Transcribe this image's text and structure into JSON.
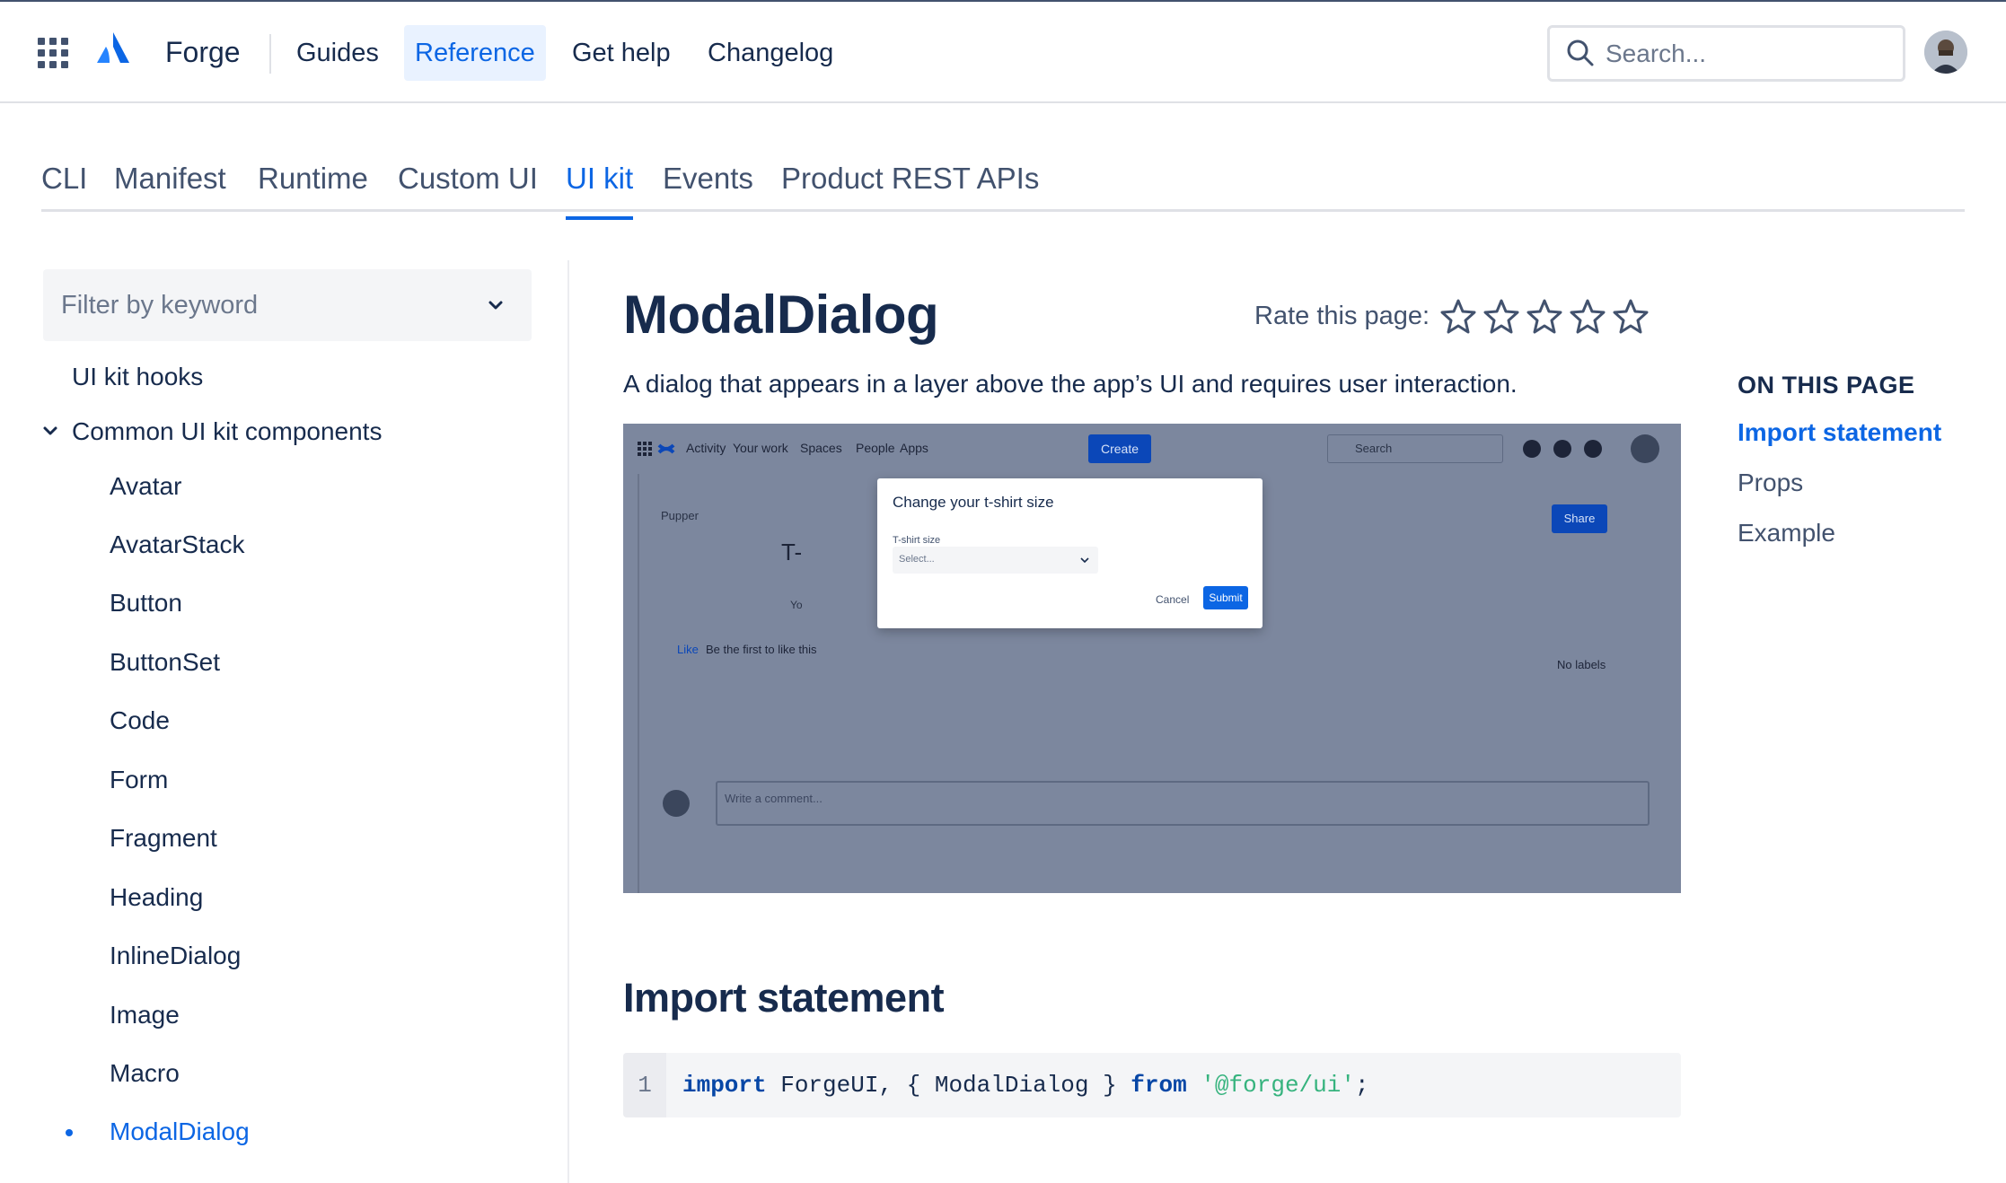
{
  "header": {
    "product": "Forge",
    "nav": [
      "Guides",
      "Reference",
      "Get help",
      "Changelog"
    ],
    "active_nav": "Reference",
    "search_placeholder": "Search..."
  },
  "ref_tabs": {
    "items": [
      "CLI",
      "Manifest",
      "Runtime",
      "Custom UI",
      "UI kit",
      "Events",
      "Product REST APIs"
    ],
    "active": "UI kit"
  },
  "sidebar": {
    "filter_placeholder": "Filter by keyword",
    "top_item": "UI kit hooks",
    "group_label": "Common UI kit components",
    "items": [
      "Avatar",
      "AvatarStack",
      "Button",
      "ButtonSet",
      "Code",
      "Form",
      "Fragment",
      "Heading",
      "InlineDialog",
      "Image",
      "Macro",
      "ModalDialog"
    ],
    "active_item": "ModalDialog"
  },
  "main": {
    "title": "ModalDialog",
    "rate_label": "Rate this page:",
    "stars": 5,
    "lead": "A dialog that appears in a layer above the app’s UI and requires user interaction.",
    "section_heading": "Import statement",
    "code": {
      "line_number": "1",
      "kw_import": "import",
      "mid": " ForgeUI, { ModalDialog } ",
      "kw_from": "from",
      "string": "'@forge/ui'",
      "end": ";"
    }
  },
  "screenshot": {
    "nav": [
      "Activity",
      "Your work",
      "Spaces",
      "People",
      "Apps"
    ],
    "create": "Create",
    "search": "Search",
    "breadcrumb": "Pupper",
    "share": "Share",
    "page_title_partial": "T-",
    "like": "Like",
    "like_hint": "Be the first to like this",
    "no_labels": "No labels",
    "comment_placeholder": "Write a comment...",
    "you_partial": "Yo",
    "modal": {
      "title": "Change your t-shirt size",
      "field_label": "T-shirt size",
      "select_placeholder": "Select...",
      "cancel": "Cancel",
      "submit": "Submit"
    }
  },
  "toc": {
    "heading": "ON THIS PAGE",
    "items": [
      "Import statement",
      "Props",
      "Example"
    ],
    "active": "Import statement"
  },
  "colors": {
    "accent": "#0c66e4",
    "text": "#172b4d",
    "muted": "#42526e",
    "figure_bg": "#7c879e"
  }
}
